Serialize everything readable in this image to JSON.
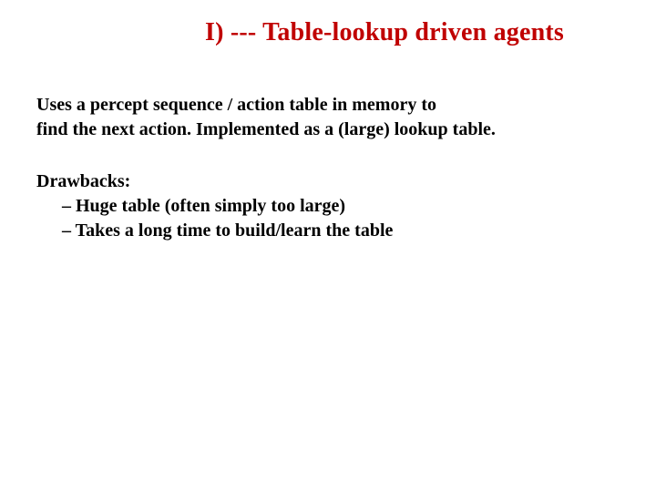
{
  "title": "I) --- Table-lookup driven agents",
  "para_line1": "Uses a percept sequence / action table in memory to",
  "para_line2": "find the next action. Implemented as a (large) lookup table.",
  "drawbacks_label": "Drawbacks:",
  "bullets": [
    "Huge table (often simply too large)",
    "Takes a long time to build/learn the table"
  ]
}
